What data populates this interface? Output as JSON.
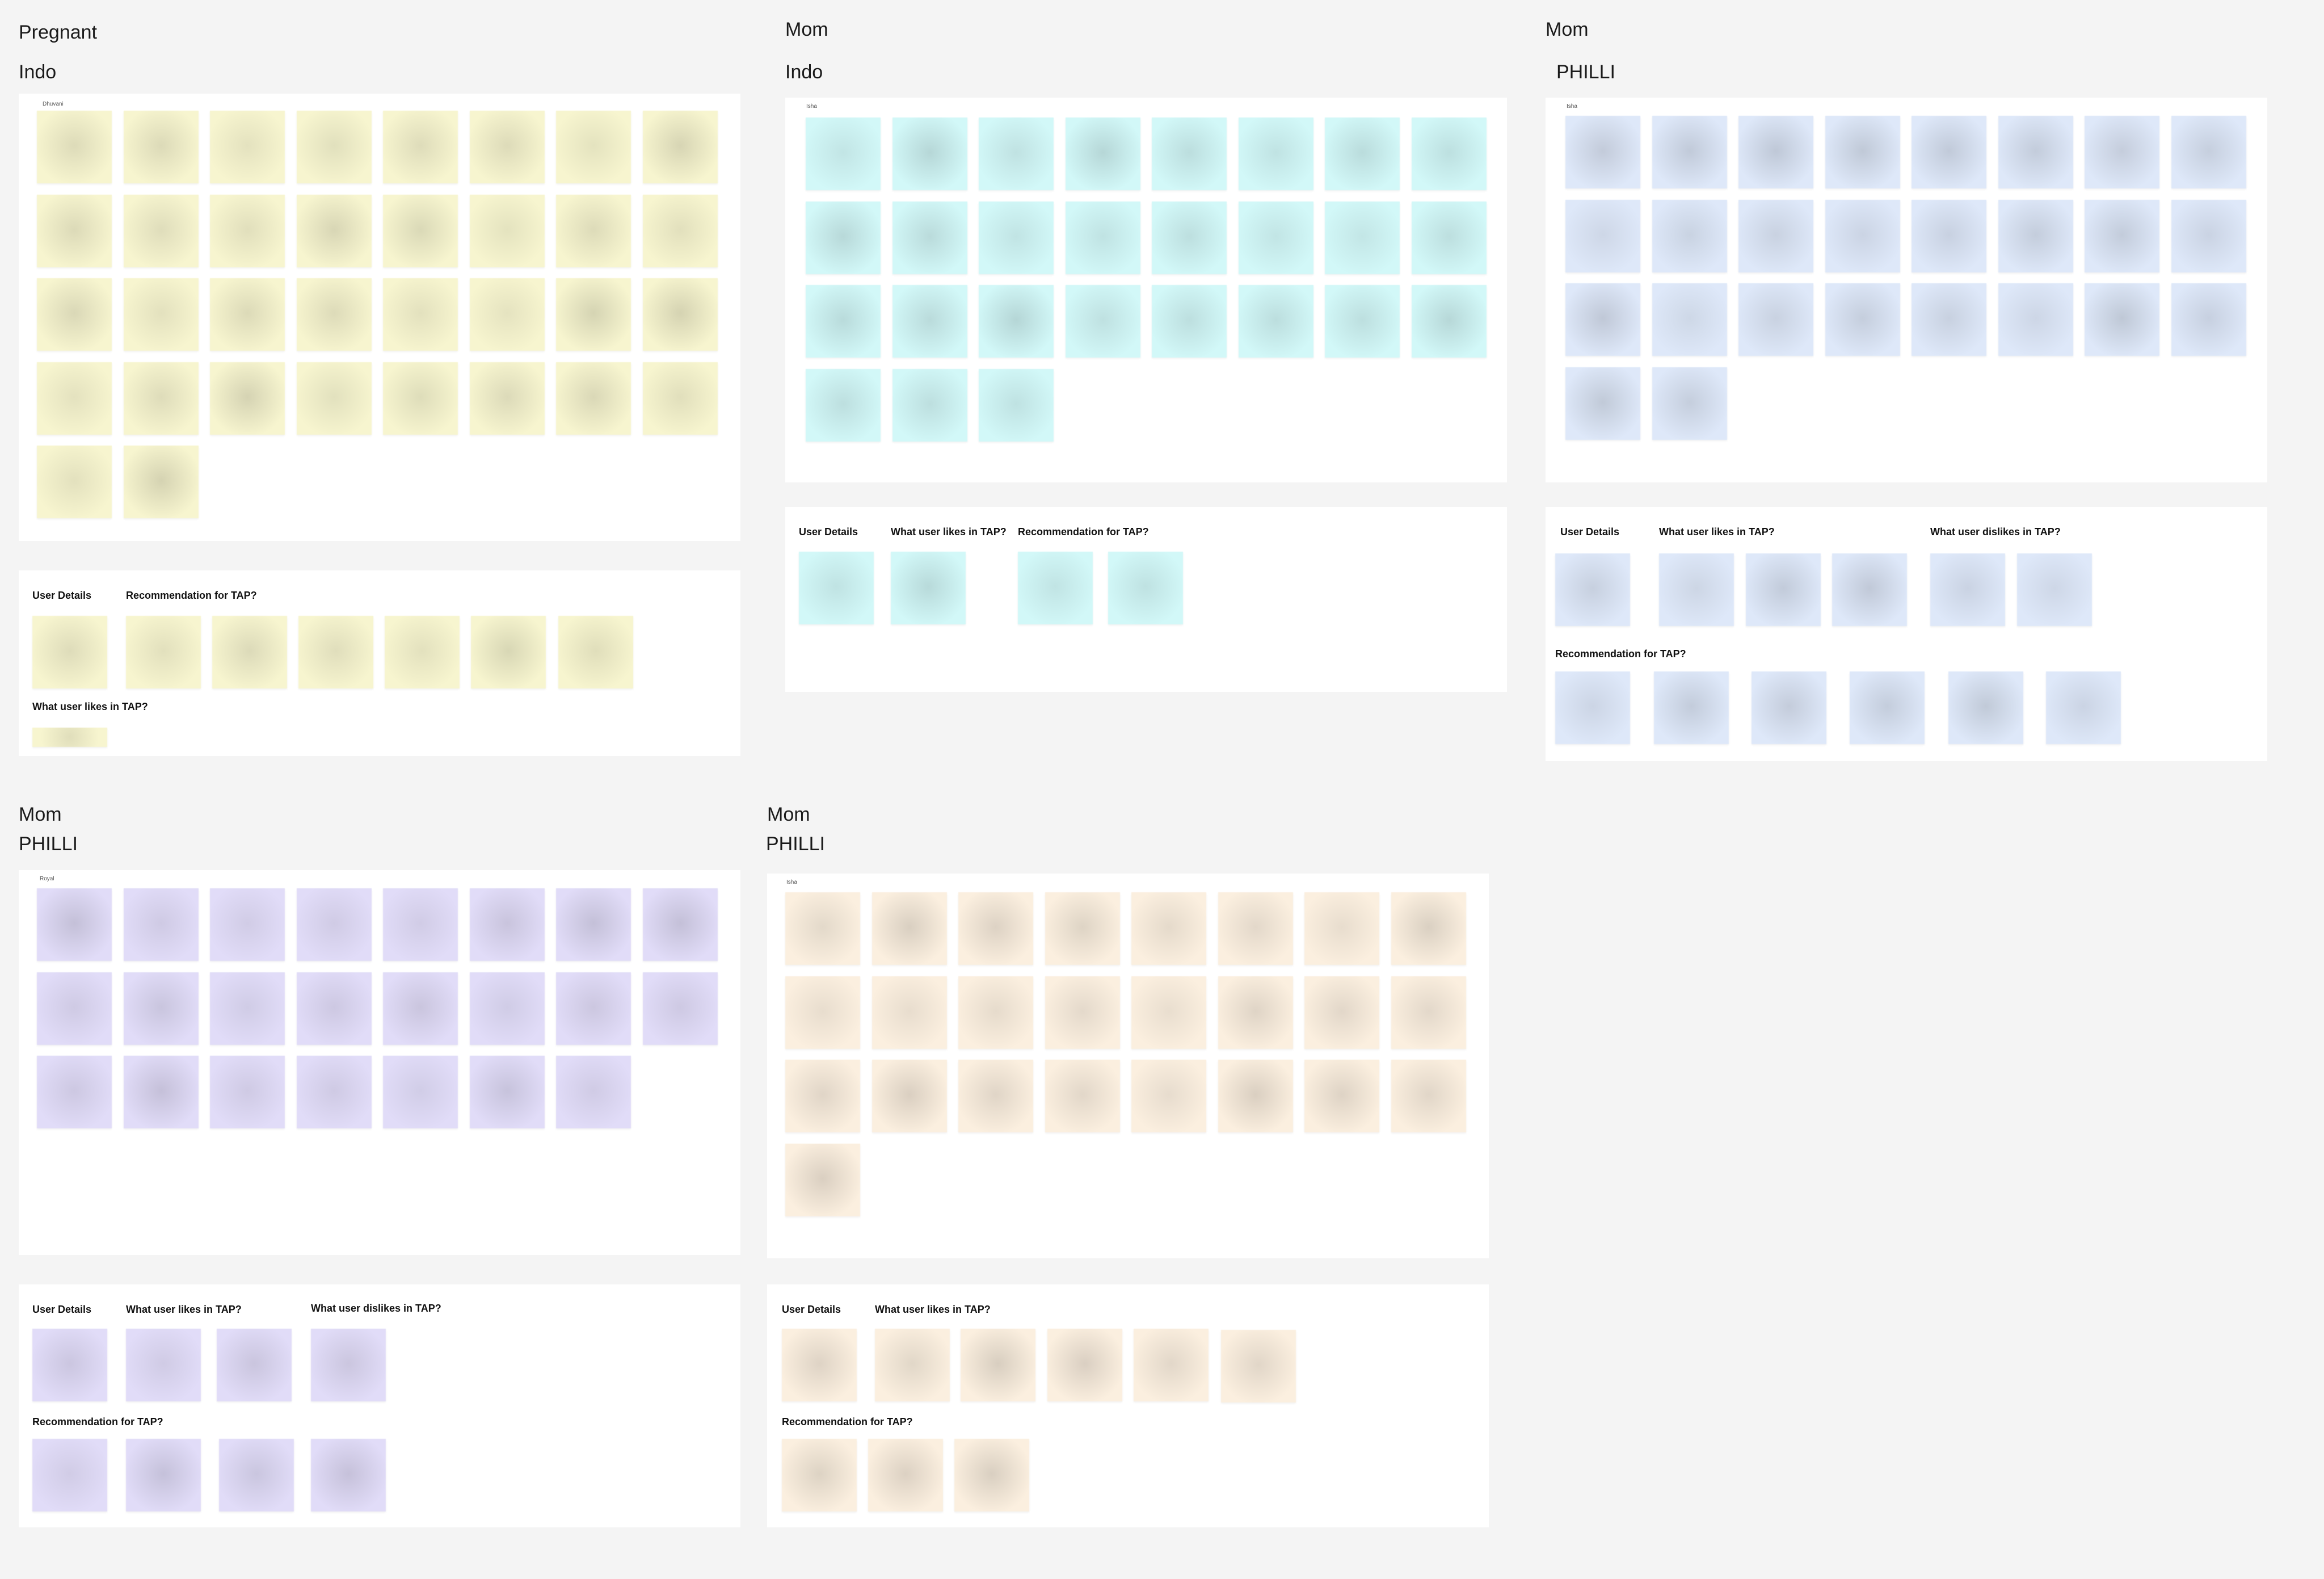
{
  "colors": {
    "background": "#f4f4f4",
    "yellow": "#f7f5cf",
    "cyan": "#d2f8f8",
    "blue": "#dee8f9",
    "purple": "#e1dcf8",
    "peach": "#fbefdf"
  },
  "clusters": [
    {
      "id": "c1",
      "category": "Pregnant",
      "country": "Indo",
      "frame_name": "Dhuvani",
      "color": "yellow",
      "grid_notes": 34,
      "sections": [
        {
          "key": "user_details",
          "title": "User Details",
          "notes": 1
        },
        {
          "key": "recommendation",
          "title": "Recommendation for TAP?",
          "notes": 6
        },
        {
          "key": "likes",
          "title": "What user likes in TAP?",
          "notes": 1
        }
      ]
    },
    {
      "id": "c2",
      "category": "Mom",
      "country": "Indo",
      "frame_name": "Isha",
      "color": "cyan",
      "grid_notes": 27,
      "sections": [
        {
          "key": "user_details",
          "title": "User Details",
          "notes": 1
        },
        {
          "key": "likes",
          "title": "What user likes in TAP?",
          "notes": 1
        },
        {
          "key": "recommendation",
          "title": "Recommendation for TAP?",
          "notes": 2
        }
      ]
    },
    {
      "id": "c3",
      "category": "Mom",
      "country": "PHILLI",
      "frame_name": "Isha",
      "color": "blue",
      "grid_notes": 26,
      "sections": [
        {
          "key": "user_details",
          "title": "User Details",
          "notes": 1
        },
        {
          "key": "likes",
          "title": "What user likes in TAP?",
          "notes": 3
        },
        {
          "key": "dislikes",
          "title": "What user dislikes in TAP?",
          "notes": 2
        },
        {
          "key": "recommendation",
          "title": "Recommendation for TAP?",
          "notes": 6
        }
      ]
    },
    {
      "id": "c4",
      "category": "Mom",
      "country": "PHILLI",
      "frame_name": "Royal",
      "color": "purple",
      "grid_notes": 23,
      "sections": [
        {
          "key": "user_details",
          "title": "User Details",
          "notes": 1
        },
        {
          "key": "likes",
          "title": "What user likes in TAP?",
          "notes": 2
        },
        {
          "key": "dislikes",
          "title": "What user dislikes in TAP?",
          "notes": 1
        },
        {
          "key": "recommendation",
          "title": "Recommendation for TAP?",
          "notes": 4
        }
      ]
    },
    {
      "id": "c5",
      "category": "Mom",
      "country": "PHILLI",
      "frame_name": "Isha",
      "color": "peach",
      "grid_notes": 25,
      "sections": [
        {
          "key": "user_details",
          "title": "User Details",
          "notes": 1
        },
        {
          "key": "likes",
          "title": "What user likes in TAP?",
          "notes": 5
        },
        {
          "key": "recommendation",
          "title": "Recommendation for TAP?",
          "notes": 3
        }
      ]
    }
  ]
}
